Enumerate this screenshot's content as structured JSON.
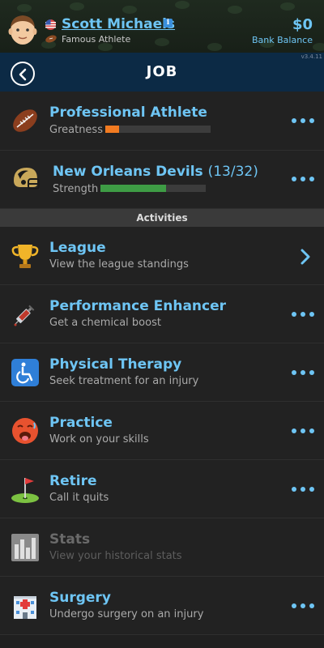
{
  "header": {
    "player_name": "Scott Michaels",
    "player_job": "Famous Athlete",
    "balance": "$0",
    "balance_label": "Bank Balance",
    "version": "v3.4.11",
    "info_icon": "i"
  },
  "titlebar": {
    "title": "JOB"
  },
  "job_rows": [
    {
      "title": "Professional Athlete",
      "stat_label": "Greatness",
      "stat_level_percent": 13,
      "stat_color": "#f27b21",
      "icon": "football-icon"
    },
    {
      "title": "New Orleans Devils",
      "count": "(13/32)",
      "stat_label": "Strength",
      "stat_level_percent": 62,
      "stat_color": "#3e9c45",
      "icon": "helmet-icon"
    }
  ],
  "section_header": "Activities",
  "activities": [
    {
      "title": "League",
      "subtitle": "View the league standings",
      "icon": "trophy-icon",
      "action": "chevron",
      "enabled": true
    },
    {
      "title": "Performance Enhancer",
      "subtitle": "Get a chemical boost",
      "icon": "syringe-icon",
      "action": "more",
      "enabled": true
    },
    {
      "title": "Physical Therapy",
      "subtitle": "Seek treatment for an injury",
      "icon": "wheelchair-icon",
      "action": "more",
      "enabled": true
    },
    {
      "title": "Practice",
      "subtitle": "Work on your skills",
      "icon": "hot-face-icon",
      "action": "more",
      "enabled": true
    },
    {
      "title": "Retire",
      "subtitle": "Call it quits",
      "icon": "golf-flag-icon",
      "action": "more",
      "enabled": true
    },
    {
      "title": "Stats",
      "subtitle": "View your historical stats",
      "icon": "stats-icon",
      "action": "none",
      "enabled": false
    },
    {
      "title": "Surgery",
      "subtitle": "Undergo surgery on an injury",
      "icon": "hospital-icon",
      "action": "more",
      "enabled": true
    }
  ],
  "colors": {
    "accent": "#6ec5f4",
    "titlebar": "#0c2a45",
    "row_bg": "#222222",
    "section_bg": "#3a3a3a"
  }
}
